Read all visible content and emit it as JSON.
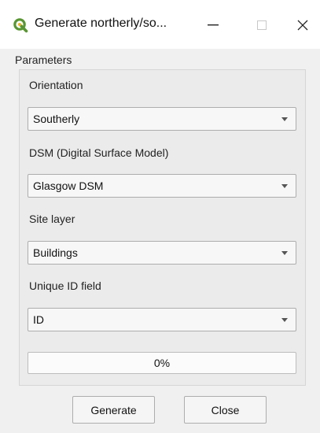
{
  "window": {
    "title": "Generate northerly/so...",
    "minimize_glyph": "—",
    "maximize_glyph": "☐",
    "close_glyph": "✕",
    "app_icon": "qgis-logo-icon",
    "brand_color": "#589632"
  },
  "parameters_label": "Parameters",
  "fields": {
    "orientation": {
      "label": "Orientation",
      "value": "Southerly"
    },
    "dsm": {
      "label": "DSM (Digital Surface Model)",
      "value": "Glasgow DSM"
    },
    "site_layer": {
      "label": "Site layer",
      "value": "Buildings"
    },
    "unique_id": {
      "label": "Unique ID field",
      "value": "ID"
    }
  },
  "progress": {
    "value": 0,
    "text": "0%"
  },
  "buttons": {
    "generate": "Generate",
    "close": "Close"
  }
}
